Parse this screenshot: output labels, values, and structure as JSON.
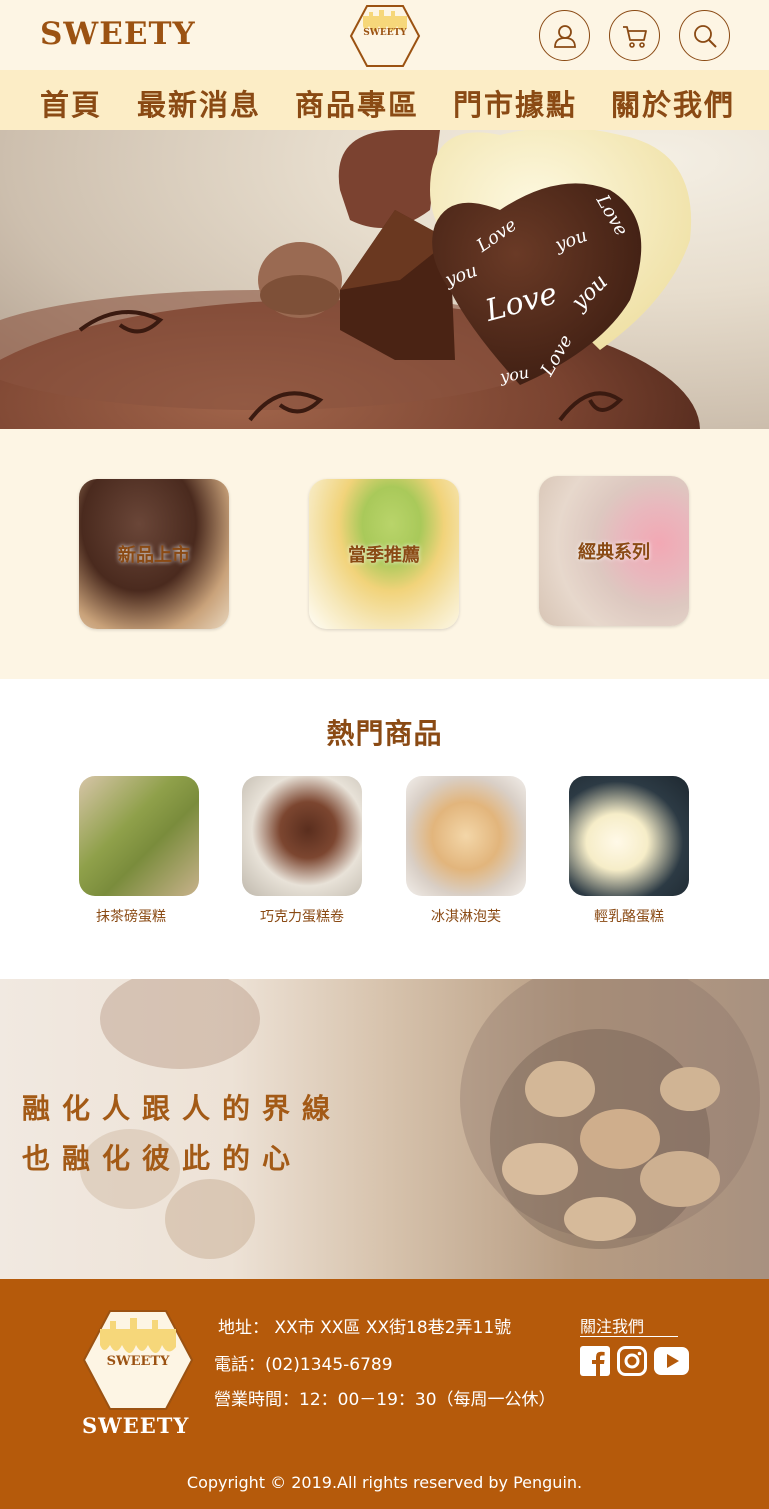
{
  "header": {
    "brand": "SWEETY",
    "logo_text": "SWEETY",
    "icons": [
      "user-icon",
      "cart-icon",
      "search-icon"
    ]
  },
  "nav": {
    "items": [
      {
        "label": "首頁"
      },
      {
        "label": "最新消息"
      },
      {
        "label": "商品專區"
      },
      {
        "label": "門市據點"
      },
      {
        "label": "關於我們"
      }
    ]
  },
  "hero": {
    "words": [
      "Love",
      "you",
      "Love",
      "you",
      "Love",
      "you",
      "Love",
      "you"
    ]
  },
  "categories": [
    {
      "label": "新品上市"
    },
    {
      "label": "當季推薦"
    },
    {
      "label": "經典系列"
    }
  ],
  "popular": {
    "title": "熱門商品",
    "items": [
      {
        "label": "抹茶磅蛋糕"
      },
      {
        "label": "巧克力蛋糕卷"
      },
      {
        "label": "冰淇淋泡芙"
      },
      {
        "label": "輕乳酪蛋糕"
      }
    ]
  },
  "banner": {
    "line1": "融化人跟人的界線",
    "line2": "也融化彼此的心"
  },
  "footer": {
    "logo_text": "SWEETY",
    "brand": "SWEETY",
    "address": "地址： XX市 XX區 XX街18巷2弄11號",
    "phone": "電話：(02)1345-6789",
    "hours": "營業時間：12：00－19：30（每周一公休）",
    "follow": "關注我們",
    "social_icons": [
      "facebook-icon",
      "instagram-icon",
      "youtube-icon"
    ],
    "copyright": "Copyright © 2019.All rights reserved by Penguin."
  },
  "colors": {
    "brand_brown": "#8a4a14",
    "header_bg": "#fdf5e4",
    "nav_bg": "#fcedc6",
    "footer_bg": "#b55a0b"
  }
}
